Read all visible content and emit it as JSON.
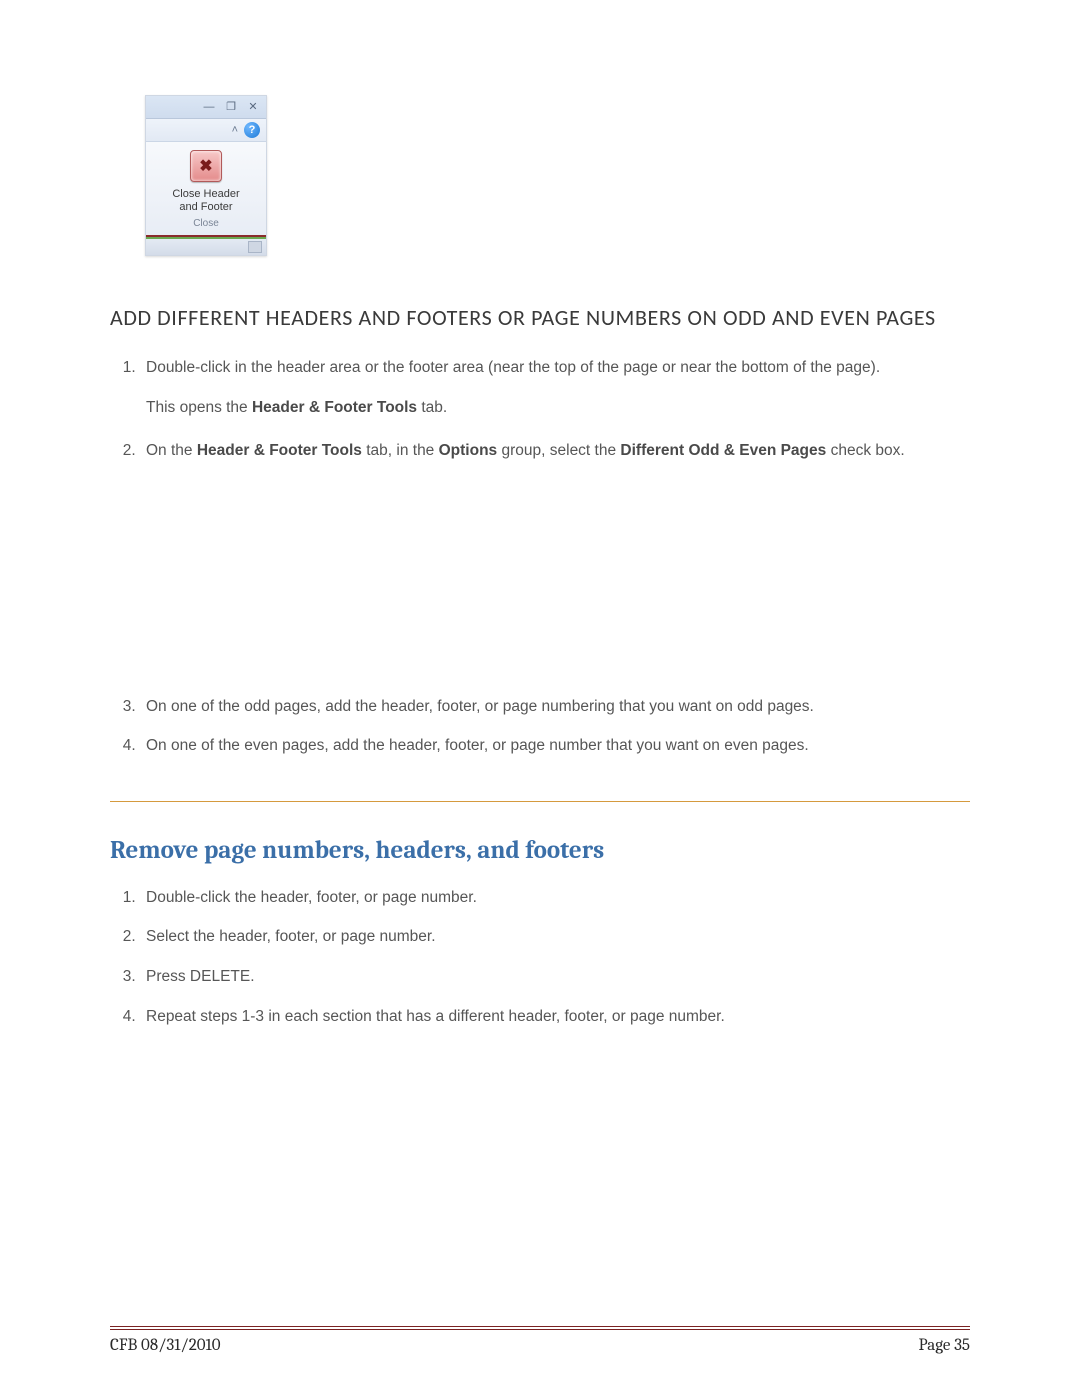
{
  "ribbon": {
    "button_line1": "Close Header",
    "button_line2": "and Footer",
    "group": "Close"
  },
  "section1": {
    "heading": "ADD DIFFERENT HEADERS AND FOOTERS OR PAGE NUMBERS ON ODD AND EVEN PAGES",
    "steps": {
      "s1a": "Double-click in the header area or the footer area (near the top of the page or near the bottom of the page).",
      "s1b_pre": "This opens the ",
      "s1b_bold": "Header & Footer Tools",
      "s1b_post": " tab.",
      "s2_p1": "On the ",
      "s2_b1": "Header & Footer Tools",
      "s2_p2": " tab, in the ",
      "s2_b2": "Options",
      "s2_p3": " group, select the ",
      "s2_b3": "Different Odd & Even Pages",
      "s2_p4": " check box.",
      "s3": "On one of the odd pages, add the header, footer, or page numbering that you want on odd pages.",
      "s4": "On one of the even pages, add the header, footer, or page number that you want on even pages."
    }
  },
  "section2": {
    "heading": "Remove page numbers, headers, and footers",
    "steps": {
      "s1": "Double-click the header, footer, or page number.",
      "s2": "Select the header, footer, or page number.",
      "s3": "Press DELETE.",
      "s4": "Repeat steps 1-3 in each section that has a different header, footer, or page number."
    }
  },
  "footer": {
    "left": "CFB 08/31/2010",
    "right": "Page 35"
  }
}
